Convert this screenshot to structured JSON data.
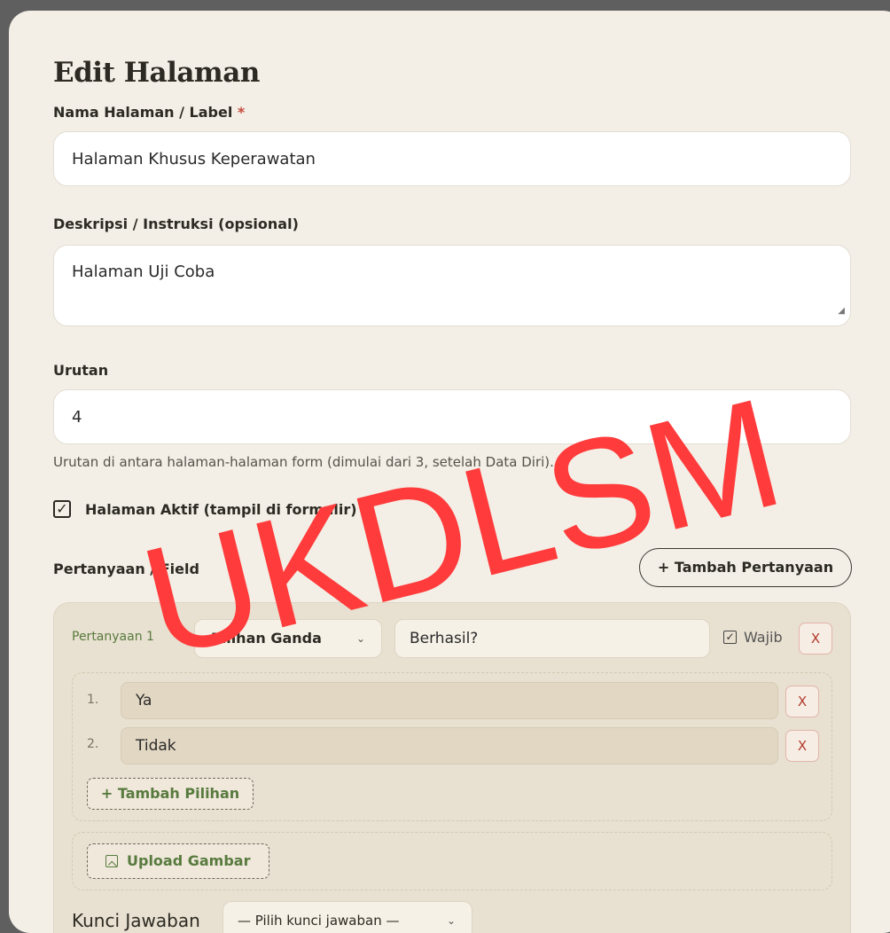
{
  "page": {
    "title": "Edit Halaman"
  },
  "fields": {
    "name": {
      "label": "Nama Halaman / Label",
      "required_mark": "*",
      "value": "Halaman Khusus Keperawatan"
    },
    "description": {
      "label": "Deskripsi / Instruksi (opsional)",
      "value": "Halaman Uji Coba"
    },
    "order": {
      "label": "Urutan",
      "value": "4",
      "help": "Urutan di antara halaman-halaman form (dimulai dari 3, setelah Data Diri)."
    },
    "active": {
      "label": "Halaman Aktif (tampil di formulir)",
      "checked": true,
      "check_glyph": "✓"
    }
  },
  "questions_section": {
    "label": "Pertanyaan / Field",
    "add_button": "+ Tambah Pertanyaan",
    "questions": [
      {
        "title": "Pertanyaan 1",
        "type": "Pilihan Ganda",
        "text": "Berhasil?",
        "required_label": "Wajib",
        "required": true,
        "remove_label": "X",
        "options": [
          {
            "num": "1.",
            "value": "Ya",
            "remove_label": "X"
          },
          {
            "num": "2.",
            "value": "Tidak",
            "remove_label": "X"
          }
        ],
        "add_option": "+ Tambah Pilihan",
        "upload": "Upload Gambar",
        "answer_key_label": "Kunci Jawaban",
        "answer_key_value": "— Pilih kunci jawaban —"
      }
    ]
  },
  "icons": {
    "chevron": "chevron-down-icon",
    "image": "image-icon",
    "checkbox": "checkbox-icon"
  },
  "watermark": {
    "text": "UKDLSM",
    "color": "#ff3b3b"
  },
  "colors": {
    "panel_bg": "#f3efe7",
    "accent_green": "#587a3e",
    "danger_red": "#b23a2e",
    "card_bg": "#e8e0d0"
  }
}
